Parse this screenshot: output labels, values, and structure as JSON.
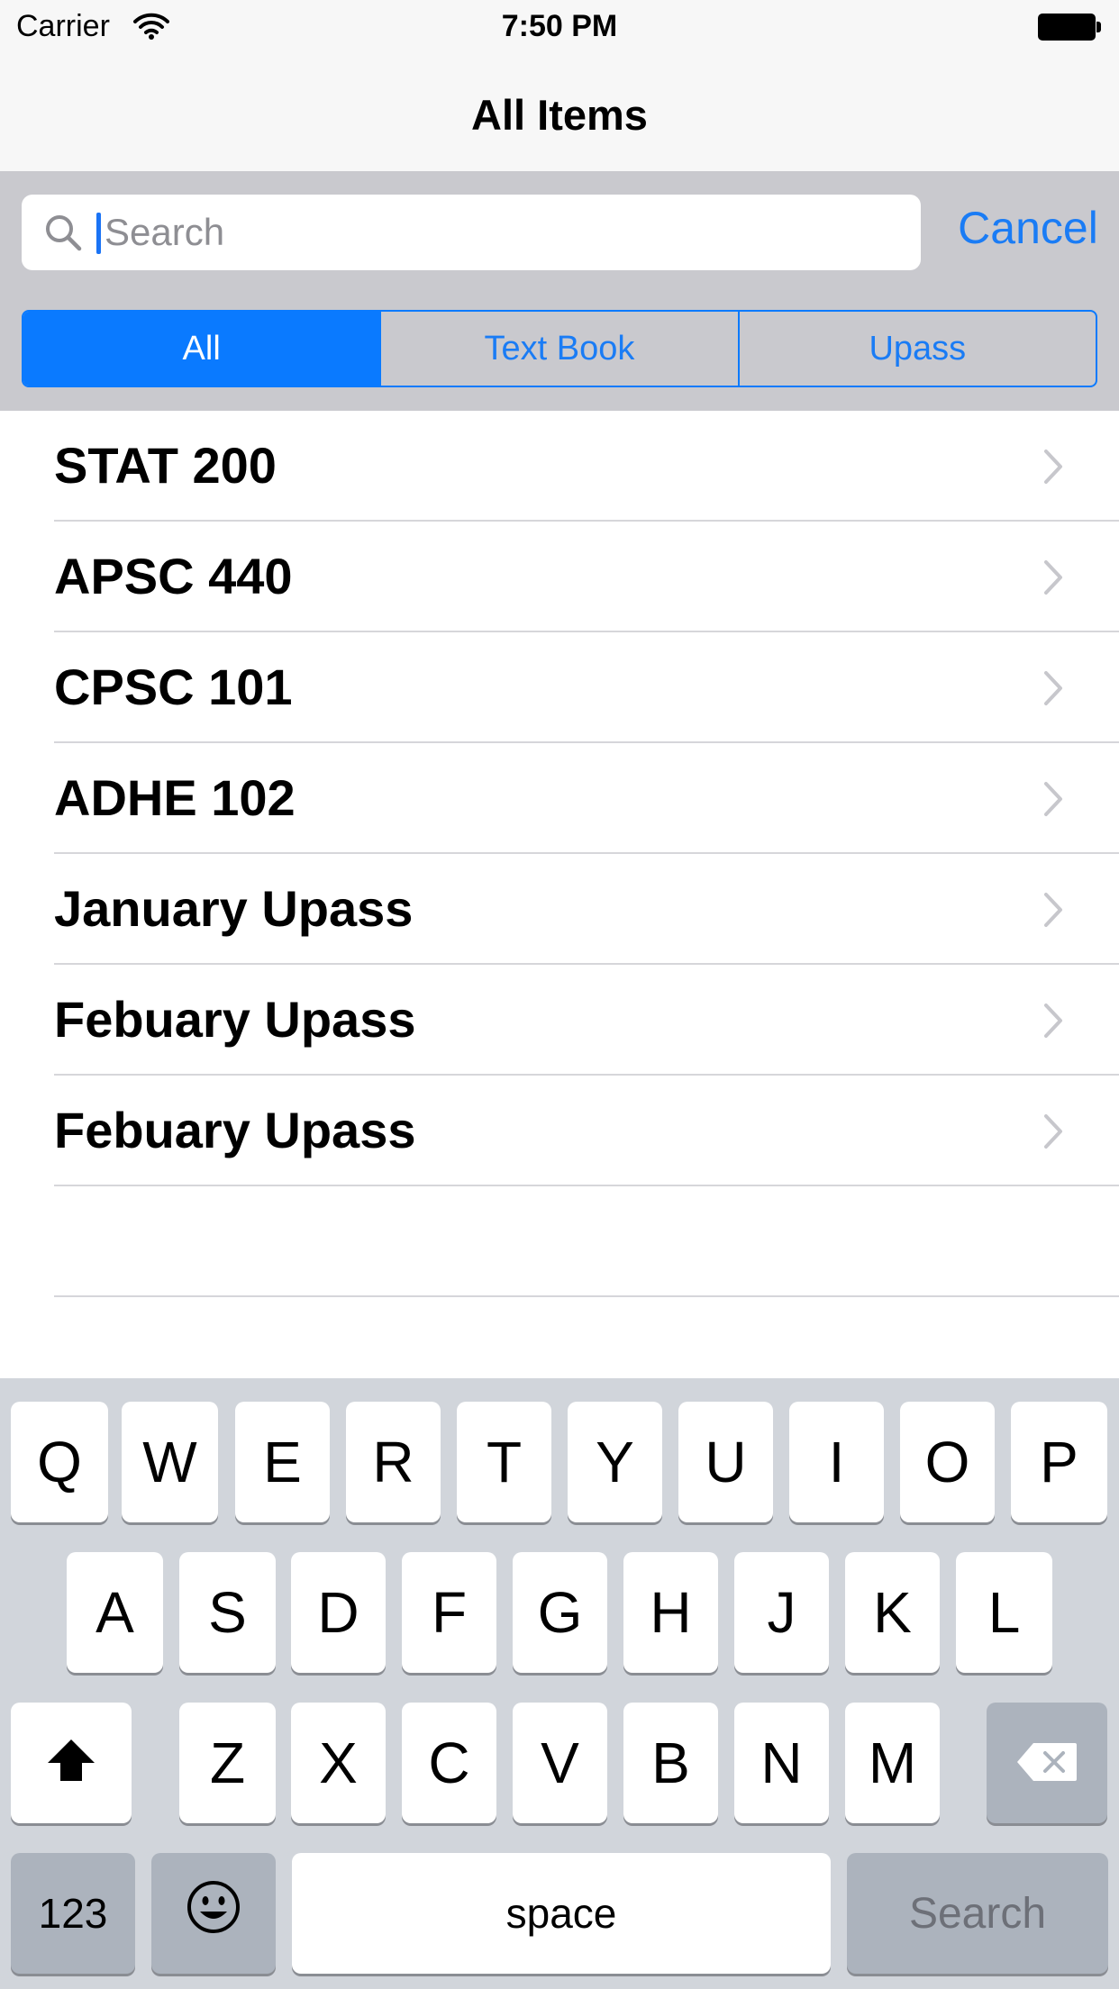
{
  "status_bar": {
    "carrier": "Carrier",
    "time": "7:50 PM",
    "wifi_icon": "wifi-icon",
    "battery_icon": "battery-icon"
  },
  "nav": {
    "title": "All Items"
  },
  "search": {
    "placeholder": "Search",
    "value": "",
    "cancel_label": "Cancel",
    "icon": "search-icon"
  },
  "scope": {
    "segments": [
      "All",
      "Text Book",
      "Upass"
    ],
    "selected": "All"
  },
  "list": {
    "items": [
      "STAT 200",
      "APSC 440",
      "CPSC 101",
      "ADHE 102",
      "January Upass",
      "Febuary Upass",
      "Febuary Upass"
    ],
    "accessory_icon": "chevron-right-icon"
  },
  "keyboard": {
    "row1": [
      "Q",
      "W",
      "E",
      "R",
      "T",
      "Y",
      "U",
      "I",
      "O",
      "P"
    ],
    "row2": [
      "A",
      "S",
      "D",
      "F",
      "G",
      "H",
      "J",
      "K",
      "L"
    ],
    "row3": [
      "Z",
      "X",
      "C",
      "V",
      "B",
      "N",
      "M"
    ],
    "shift_icon": "shift-icon",
    "delete_icon": "delete-icon",
    "numbers_label": "123",
    "emoji_icon": "emoji-icon",
    "space_label": "space",
    "search_label": "Search"
  },
  "colors": {
    "accent": "#0a7aff",
    "search_bar_bg": "#c9c9ce",
    "keyboard_bg": "#d1d5db",
    "dark_key": "#acb3bd"
  }
}
